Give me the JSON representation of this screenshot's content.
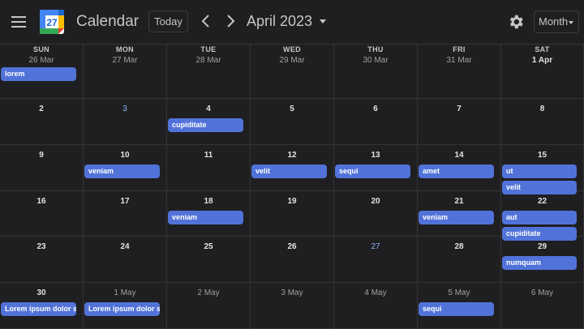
{
  "header": {
    "app_title": "Calendar",
    "logo_day": "27",
    "today_label": "Today",
    "month_label": "April 2023",
    "view_label": "Month"
  },
  "weekdays": [
    "SUN",
    "MON",
    "TUE",
    "WED",
    "THU",
    "FRI",
    "SAT"
  ],
  "weeks": [
    [
      {
        "date": "26 Mar",
        "style": "other",
        "events": [
          "lorem"
        ]
      },
      {
        "date": "27 Mar",
        "style": "other",
        "events": []
      },
      {
        "date": "28 Mar",
        "style": "other",
        "events": []
      },
      {
        "date": "29 Mar",
        "style": "other",
        "events": []
      },
      {
        "date": "30 Mar",
        "style": "other",
        "events": []
      },
      {
        "date": "31 Mar",
        "style": "other",
        "events": []
      },
      {
        "date": "1 Apr",
        "style": "",
        "events": []
      }
    ],
    [
      {
        "date": "2",
        "style": "",
        "events": []
      },
      {
        "date": "3",
        "style": "blue",
        "events": []
      },
      {
        "date": "4",
        "style": "",
        "events": [
          "cupiditate"
        ]
      },
      {
        "date": "5",
        "style": "",
        "events": []
      },
      {
        "date": "6",
        "style": "",
        "events": []
      },
      {
        "date": "7",
        "style": "",
        "events": []
      },
      {
        "date": "8",
        "style": "",
        "events": []
      }
    ],
    [
      {
        "date": "9",
        "style": "",
        "events": []
      },
      {
        "date": "10",
        "style": "",
        "events": [
          "veniam"
        ]
      },
      {
        "date": "11",
        "style": "",
        "events": []
      },
      {
        "date": "12",
        "style": "",
        "events": [
          "velit"
        ]
      },
      {
        "date": "13",
        "style": "",
        "events": [
          "sequi"
        ]
      },
      {
        "date": "14",
        "style": "",
        "events": [
          "amet"
        ]
      },
      {
        "date": "15",
        "style": "",
        "events": [
          "ut",
          "velit"
        ]
      }
    ],
    [
      {
        "date": "16",
        "style": "",
        "events": []
      },
      {
        "date": "17",
        "style": "",
        "events": []
      },
      {
        "date": "18",
        "style": "",
        "events": [
          "veniam"
        ]
      },
      {
        "date": "19",
        "style": "",
        "events": []
      },
      {
        "date": "20",
        "style": "",
        "events": []
      },
      {
        "date": "21",
        "style": "",
        "events": [
          "veniam"
        ]
      },
      {
        "date": "22",
        "style": "",
        "events": [
          "aut",
          "cupiditate"
        ]
      }
    ],
    [
      {
        "date": "23",
        "style": "",
        "events": []
      },
      {
        "date": "24",
        "style": "",
        "events": []
      },
      {
        "date": "25",
        "style": "",
        "events": []
      },
      {
        "date": "26",
        "style": "",
        "events": []
      },
      {
        "date": "27",
        "style": "blue",
        "events": []
      },
      {
        "date": "28",
        "style": "",
        "events": []
      },
      {
        "date": "29",
        "style": "",
        "events": [
          "numquam"
        ]
      }
    ],
    [
      {
        "date": "30",
        "style": "",
        "events": [
          "Lorem ipsum dolor si"
        ]
      },
      {
        "date": "1 May",
        "style": "other",
        "events": [
          "Lorem ipsum dolor si"
        ]
      },
      {
        "date": "2 May",
        "style": "other",
        "events": []
      },
      {
        "date": "3 May",
        "style": "other",
        "events": []
      },
      {
        "date": "4 May",
        "style": "other",
        "events": []
      },
      {
        "date": "5 May",
        "style": "other",
        "events": [
          "sequi"
        ]
      },
      {
        "date": "6 May",
        "style": "other",
        "events": []
      }
    ]
  ],
  "colors": {
    "event": "#5173d9",
    "background": "#1f1f21",
    "accent_date": "#8ab4f8"
  }
}
